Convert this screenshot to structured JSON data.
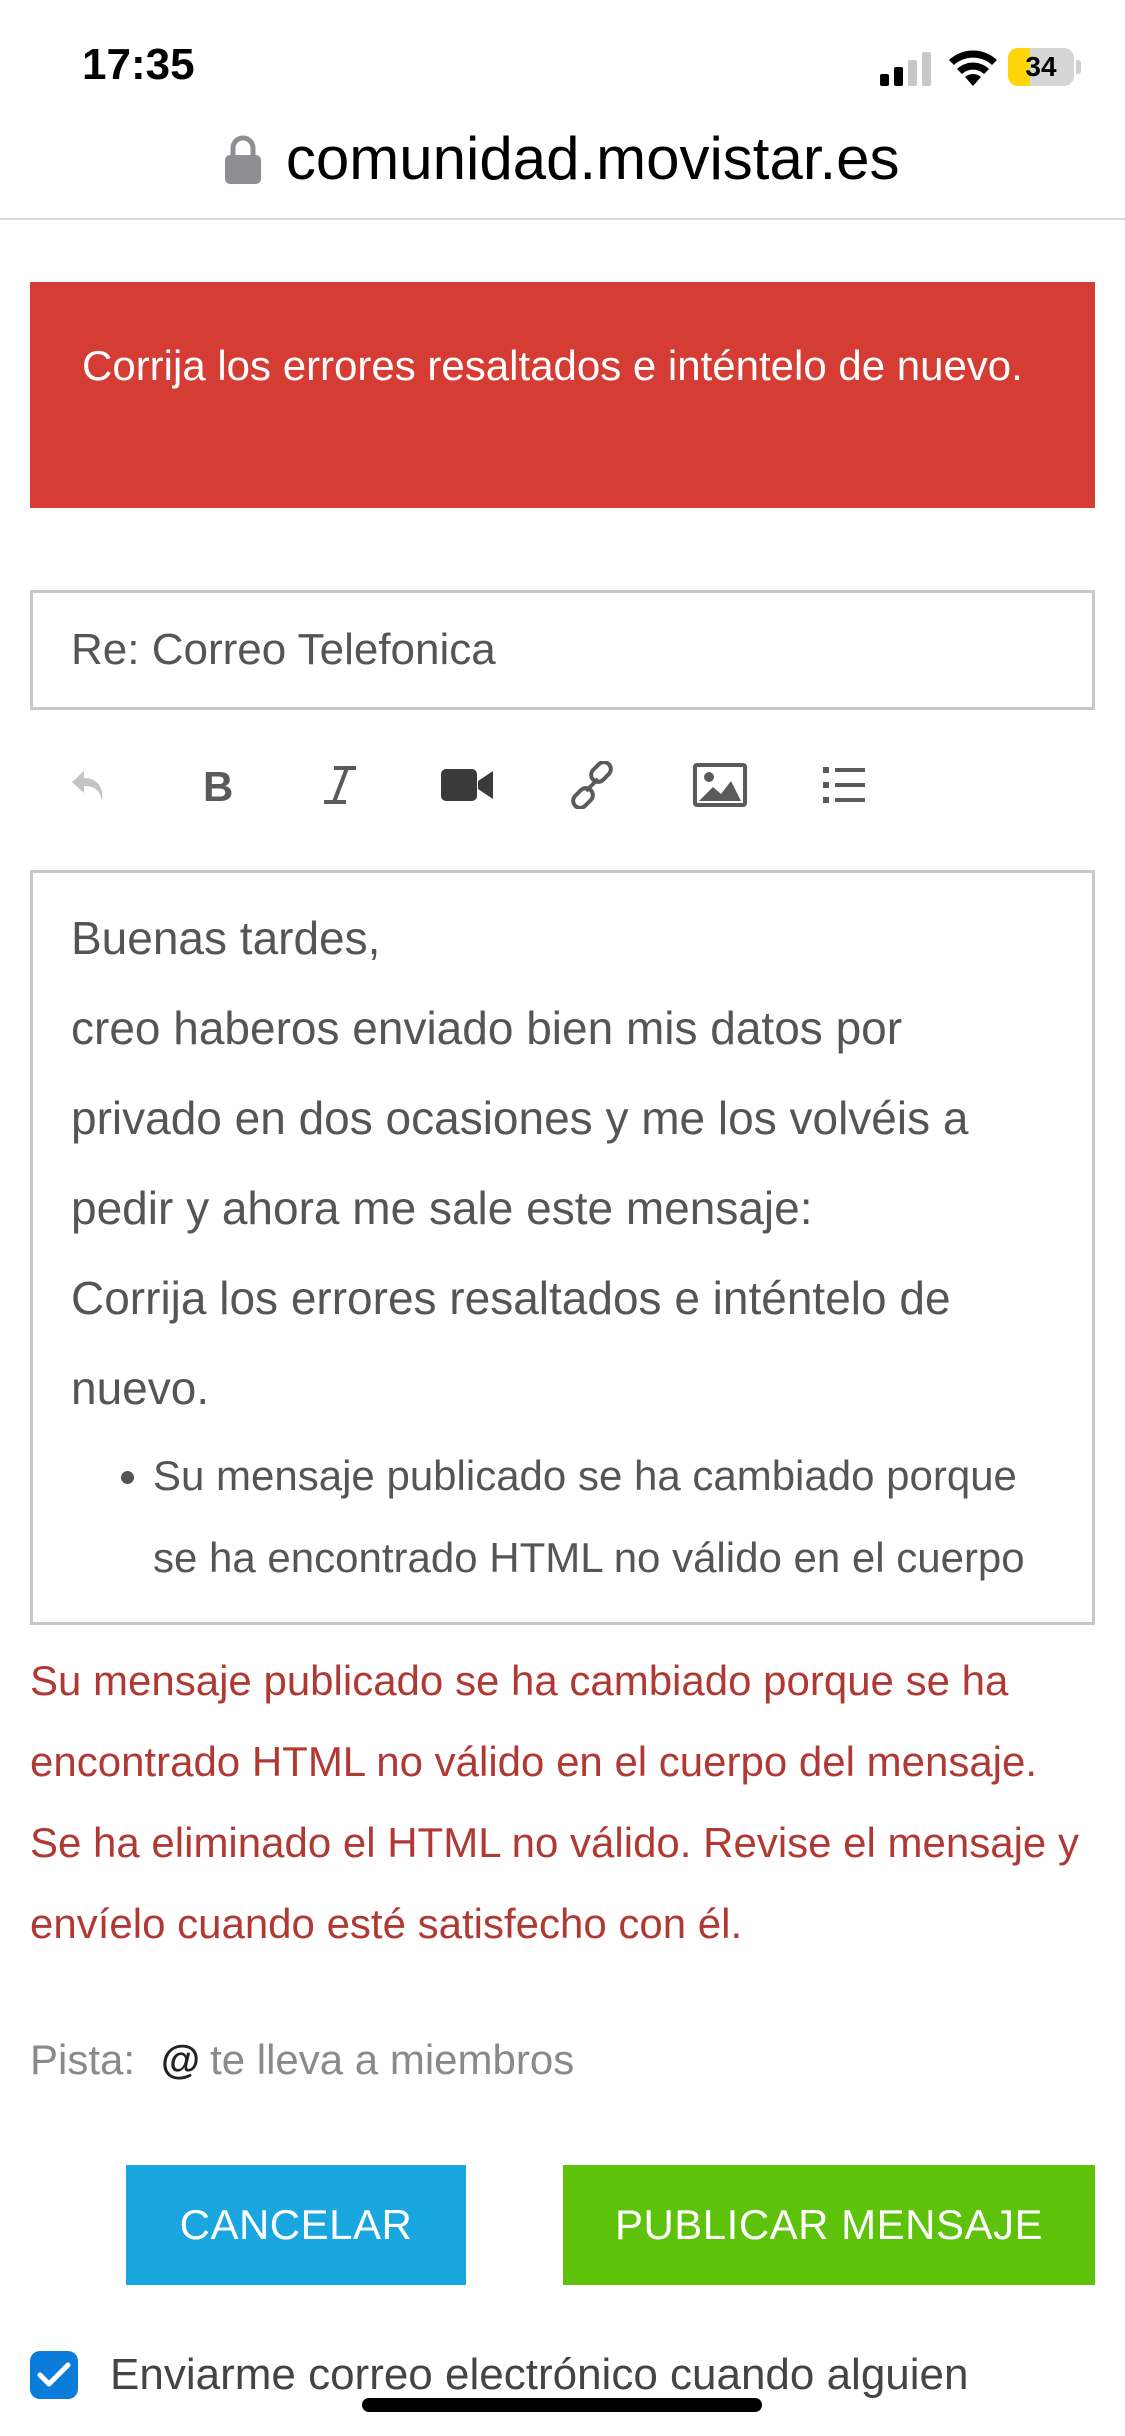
{
  "status_bar": {
    "time": "17:35",
    "battery": "34",
    "battery_level": 0.34
  },
  "browser": {
    "url": "comunidad.movistar.es"
  },
  "error_banner": {
    "text": "Corrija los errores resaltados e inténtelo de nuevo."
  },
  "subject": {
    "value": "Re: Correo Telefonica"
  },
  "toolbar": {
    "icons": [
      "undo-icon",
      "bold-icon",
      "italic-icon",
      "video-icon",
      "link-icon",
      "image-icon",
      "list-icon"
    ]
  },
  "editor": {
    "lines": [
      "Buenas tardes,",
      "creo haberos enviado bien mis datos por privado en dos ocasiones y me los volvéis a pedir y ahora me sale este mensaje:",
      "Corrija los errores resaltados e inténtelo de nuevo."
    ],
    "bullet": "Su mensaje publicado se ha cambiado porque se ha encontrado HTML no válido en el cuerpo del mensaje. Se ha eliminado el HTML no válido."
  },
  "error_message": {
    "text": "Su mensaje publicado se ha cambiado porque se ha encontrado HTML no válido en el cuerpo del mensaje. Se ha eliminado el HTML no válido. Revise el mensaje y envíelo cuando esté satisfecho con él."
  },
  "hint": {
    "label": "Pista:",
    "symbol": "@",
    "text": "te lleva a miembros"
  },
  "buttons": {
    "cancel": "CANCELAR",
    "publish": "PUBLICAR MENSAJE"
  },
  "notify": {
    "checked": true,
    "label": "Enviarme correo electrónico cuando alguien"
  },
  "colors": {
    "error_banner": "#d53c33",
    "error_text": "#b03a33",
    "cancel_button": "#1aa7e0",
    "publish_button": "#5ec20a",
    "checkbox": "#0a7ddb",
    "battery": "#ffd60a"
  }
}
